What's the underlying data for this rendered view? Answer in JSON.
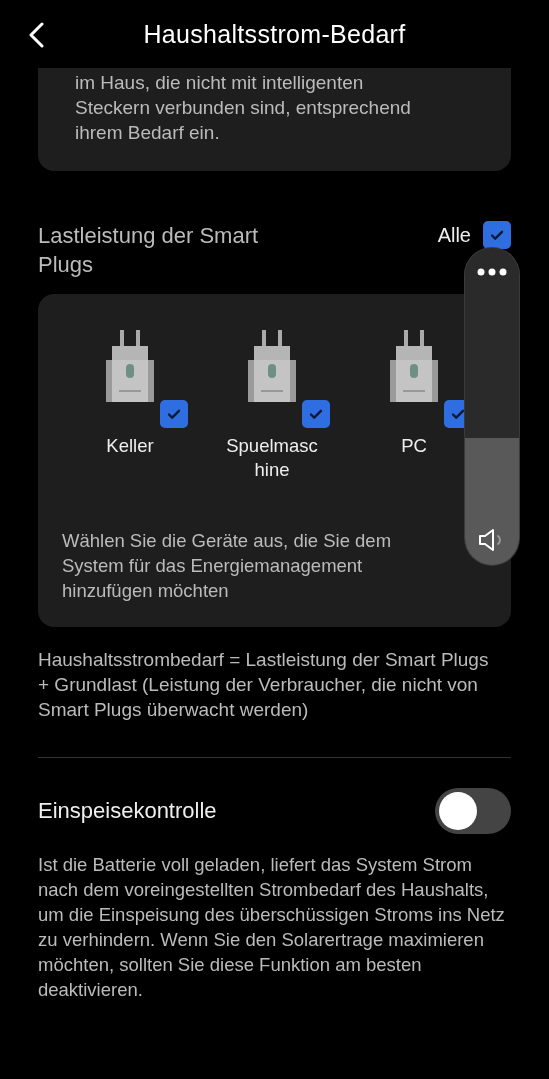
{
  "header": {
    "title": "Haushaltsstrom-Bedarf"
  },
  "intro_card": {
    "text": "im Haus, die nicht mit intelligenten Steckern verbunden sind, entsprechend ihrem Bedarf ein."
  },
  "smart_plugs": {
    "title": "Lastleistung der Smart Plugs",
    "select_all": {
      "label": "Alle",
      "checked": true
    },
    "plugs": [
      {
        "name": "Keller",
        "checked": true
      },
      {
        "name": "Spuelmaschine",
        "checked": true
      },
      {
        "name": "PC",
        "checked": true
      }
    ],
    "hint": "Wählen Sie die Geräte aus, die Sie dem System für das Energiemanagement hinzufügen möchten"
  },
  "formula": "Haushaltsstrombedarf = Lastleistung der Smart Plugs + Grundlast (Leistung der Verbraucher, die nicht von Smart Plugs überwacht werden)",
  "feed_in": {
    "label": "Einspeisekontrolle",
    "on": false,
    "description": "Ist die Batterie voll geladen, liefert das System Strom nach dem voreingestellten Strombedarf des Haushalts, um die Einspeisung des überschüssigen Stroms ins Netz zu verhindern. Wenn Sie den Solarertrage maximieren möchten, sollten Sie diese Funktion am besten deaktivieren."
  },
  "volume_panel": {
    "level": 0.4
  }
}
